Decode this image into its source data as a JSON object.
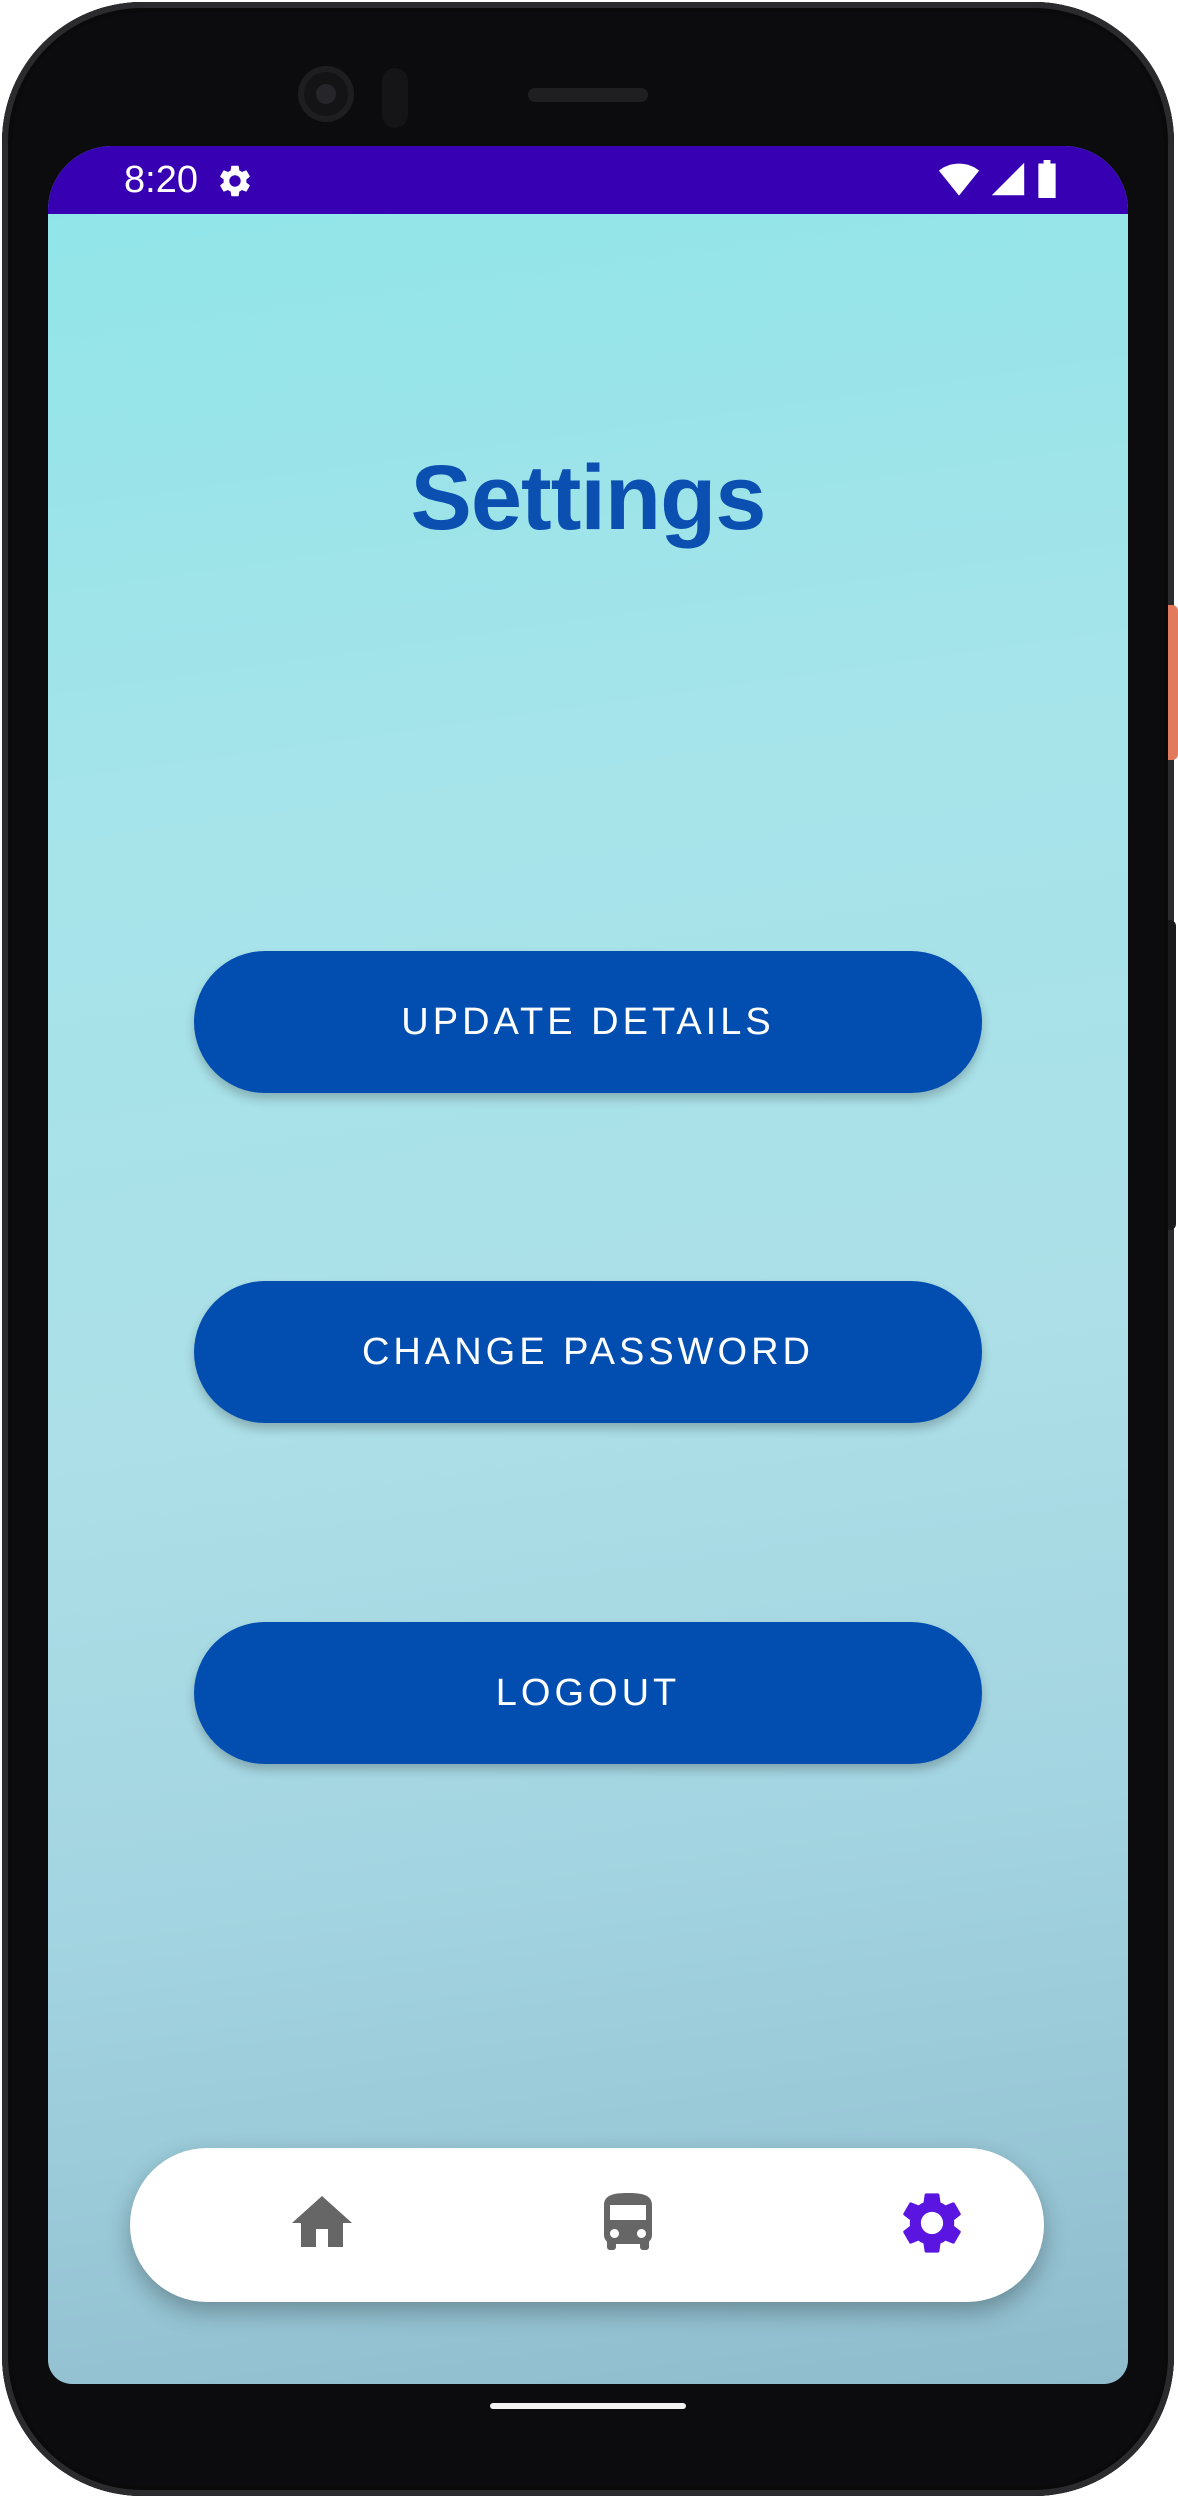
{
  "status_bar": {
    "time": "8:20",
    "background_color": "#3700b3",
    "icons": [
      "settings-icon",
      "wifi-icon",
      "cell-signal-icon",
      "battery-icon"
    ]
  },
  "page": {
    "title": "Settings",
    "title_color": "#0b4fb0"
  },
  "actions": {
    "update_details": "UPDATE DETAILS",
    "change_password": "CHANGE PASSWORD",
    "logout": "LOGOUT",
    "button_color": "#024db0"
  },
  "bottom_nav": {
    "items": [
      {
        "icon": "home-icon",
        "selected": false
      },
      {
        "icon": "bus-icon",
        "selected": false
      },
      {
        "icon": "settings-icon",
        "selected": true
      }
    ],
    "selected_color": "#5a16e0",
    "unselected_color": "#666666"
  }
}
